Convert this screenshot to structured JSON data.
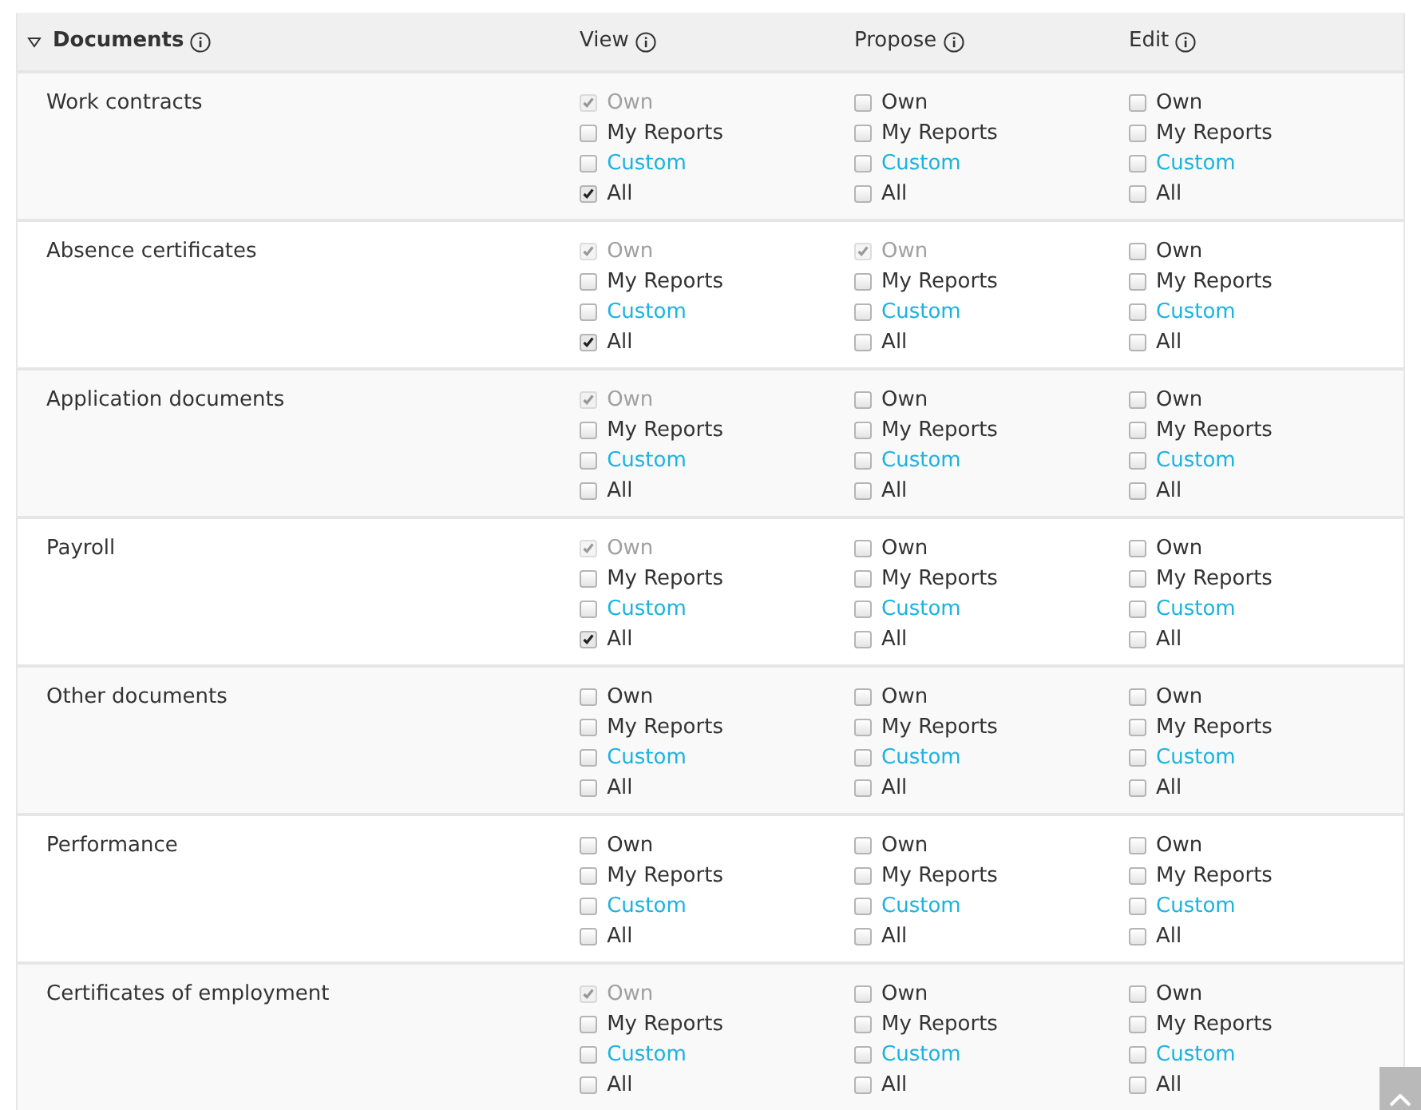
{
  "header": {
    "title": "Documents",
    "expanded": true,
    "columns": [
      "View",
      "Propose",
      "Edit"
    ]
  },
  "rows": [
    {
      "name": "Work contracts",
      "permissions": [
        [
          {
            "label": "Own",
            "kind": "plain",
            "checked": true,
            "disabled": true
          },
          {
            "label": "My Reports",
            "kind": "plain",
            "checked": false,
            "disabled": false
          },
          {
            "label": "Custom",
            "kind": "link",
            "checked": false,
            "disabled": false
          },
          {
            "label": "All",
            "kind": "plain",
            "checked": true,
            "disabled": false
          }
        ],
        [
          {
            "label": "Own",
            "kind": "plain",
            "checked": false,
            "disabled": false
          },
          {
            "label": "My Reports",
            "kind": "plain",
            "checked": false,
            "disabled": false
          },
          {
            "label": "Custom",
            "kind": "link",
            "checked": false,
            "disabled": false
          },
          {
            "label": "All",
            "kind": "plain",
            "checked": false,
            "disabled": false
          }
        ],
        [
          {
            "label": "Own",
            "kind": "plain",
            "checked": false,
            "disabled": false
          },
          {
            "label": "My Reports",
            "kind": "plain",
            "checked": false,
            "disabled": false
          },
          {
            "label": "Custom",
            "kind": "link",
            "checked": false,
            "disabled": false
          },
          {
            "label": "All",
            "kind": "plain",
            "checked": false,
            "disabled": false
          }
        ]
      ]
    },
    {
      "name": "Absence certificates",
      "permissions": [
        [
          {
            "label": "Own",
            "kind": "plain",
            "checked": true,
            "disabled": true
          },
          {
            "label": "My Reports",
            "kind": "plain",
            "checked": false,
            "disabled": false
          },
          {
            "label": "Custom",
            "kind": "link",
            "checked": false,
            "disabled": false
          },
          {
            "label": "All",
            "kind": "plain",
            "checked": true,
            "disabled": false
          }
        ],
        [
          {
            "label": "Own",
            "kind": "plain",
            "checked": true,
            "disabled": true
          },
          {
            "label": "My Reports",
            "kind": "plain",
            "checked": false,
            "disabled": false
          },
          {
            "label": "Custom",
            "kind": "link",
            "checked": false,
            "disabled": false
          },
          {
            "label": "All",
            "kind": "plain",
            "checked": false,
            "disabled": false
          }
        ],
        [
          {
            "label": "Own",
            "kind": "plain",
            "checked": false,
            "disabled": false
          },
          {
            "label": "My Reports",
            "kind": "plain",
            "checked": false,
            "disabled": false
          },
          {
            "label": "Custom",
            "kind": "link",
            "checked": false,
            "disabled": false
          },
          {
            "label": "All",
            "kind": "plain",
            "checked": false,
            "disabled": false
          }
        ]
      ]
    },
    {
      "name": "Application documents",
      "permissions": [
        [
          {
            "label": "Own",
            "kind": "plain",
            "checked": true,
            "disabled": true
          },
          {
            "label": "My Reports",
            "kind": "plain",
            "checked": false,
            "disabled": false
          },
          {
            "label": "Custom",
            "kind": "link",
            "checked": false,
            "disabled": false
          },
          {
            "label": "All",
            "kind": "plain",
            "checked": false,
            "disabled": false
          }
        ],
        [
          {
            "label": "Own",
            "kind": "plain",
            "checked": false,
            "disabled": false
          },
          {
            "label": "My Reports",
            "kind": "plain",
            "checked": false,
            "disabled": false
          },
          {
            "label": "Custom",
            "kind": "link",
            "checked": false,
            "disabled": false
          },
          {
            "label": "All",
            "kind": "plain",
            "checked": false,
            "disabled": false
          }
        ],
        [
          {
            "label": "Own",
            "kind": "plain",
            "checked": false,
            "disabled": false
          },
          {
            "label": "My Reports",
            "kind": "plain",
            "checked": false,
            "disabled": false
          },
          {
            "label": "Custom",
            "kind": "link",
            "checked": false,
            "disabled": false
          },
          {
            "label": "All",
            "kind": "plain",
            "checked": false,
            "disabled": false
          }
        ]
      ]
    },
    {
      "name": "Payroll",
      "permissions": [
        [
          {
            "label": "Own",
            "kind": "plain",
            "checked": true,
            "disabled": true
          },
          {
            "label": "My Reports",
            "kind": "plain",
            "checked": false,
            "disabled": false
          },
          {
            "label": "Custom",
            "kind": "link",
            "checked": false,
            "disabled": false
          },
          {
            "label": "All",
            "kind": "plain",
            "checked": true,
            "disabled": false
          }
        ],
        [
          {
            "label": "Own",
            "kind": "plain",
            "checked": false,
            "disabled": false
          },
          {
            "label": "My Reports",
            "kind": "plain",
            "checked": false,
            "disabled": false
          },
          {
            "label": "Custom",
            "kind": "link",
            "checked": false,
            "disabled": false
          },
          {
            "label": "All",
            "kind": "plain",
            "checked": false,
            "disabled": false
          }
        ],
        [
          {
            "label": "Own",
            "kind": "plain",
            "checked": false,
            "disabled": false
          },
          {
            "label": "My Reports",
            "kind": "plain",
            "checked": false,
            "disabled": false
          },
          {
            "label": "Custom",
            "kind": "link",
            "checked": false,
            "disabled": false
          },
          {
            "label": "All",
            "kind": "plain",
            "checked": false,
            "disabled": false
          }
        ]
      ]
    },
    {
      "name": "Other documents",
      "permissions": [
        [
          {
            "label": "Own",
            "kind": "plain",
            "checked": false,
            "disabled": false
          },
          {
            "label": "My Reports",
            "kind": "plain",
            "checked": false,
            "disabled": false
          },
          {
            "label": "Custom",
            "kind": "link",
            "checked": false,
            "disabled": false
          },
          {
            "label": "All",
            "kind": "plain",
            "checked": false,
            "disabled": false
          }
        ],
        [
          {
            "label": "Own",
            "kind": "plain",
            "checked": false,
            "disabled": false
          },
          {
            "label": "My Reports",
            "kind": "plain",
            "checked": false,
            "disabled": false
          },
          {
            "label": "Custom",
            "kind": "link",
            "checked": false,
            "disabled": false
          },
          {
            "label": "All",
            "kind": "plain",
            "checked": false,
            "disabled": false
          }
        ],
        [
          {
            "label": "Own",
            "kind": "plain",
            "checked": false,
            "disabled": false
          },
          {
            "label": "My Reports",
            "kind": "plain",
            "checked": false,
            "disabled": false
          },
          {
            "label": "Custom",
            "kind": "link",
            "checked": false,
            "disabled": false
          },
          {
            "label": "All",
            "kind": "plain",
            "checked": false,
            "disabled": false
          }
        ]
      ]
    },
    {
      "name": "Performance",
      "permissions": [
        [
          {
            "label": "Own",
            "kind": "plain",
            "checked": false,
            "disabled": false
          },
          {
            "label": "My Reports",
            "kind": "plain",
            "checked": false,
            "disabled": false
          },
          {
            "label": "Custom",
            "kind": "link",
            "checked": false,
            "disabled": false
          },
          {
            "label": "All",
            "kind": "plain",
            "checked": false,
            "disabled": false
          }
        ],
        [
          {
            "label": "Own",
            "kind": "plain",
            "checked": false,
            "disabled": false
          },
          {
            "label": "My Reports",
            "kind": "plain",
            "checked": false,
            "disabled": false
          },
          {
            "label": "Custom",
            "kind": "link",
            "checked": false,
            "disabled": false
          },
          {
            "label": "All",
            "kind": "plain",
            "checked": false,
            "disabled": false
          }
        ],
        [
          {
            "label": "Own",
            "kind": "plain",
            "checked": false,
            "disabled": false
          },
          {
            "label": "My Reports",
            "kind": "plain",
            "checked": false,
            "disabled": false
          },
          {
            "label": "Custom",
            "kind": "link",
            "checked": false,
            "disabled": false
          },
          {
            "label": "All",
            "kind": "plain",
            "checked": false,
            "disabled": false
          }
        ]
      ]
    },
    {
      "name": "Certificates of employment",
      "permissions": [
        [
          {
            "label": "Own",
            "kind": "plain",
            "checked": true,
            "disabled": true
          },
          {
            "label": "My Reports",
            "kind": "plain",
            "checked": false,
            "disabled": false
          },
          {
            "label": "Custom",
            "kind": "link",
            "checked": false,
            "disabled": false
          },
          {
            "label": "All",
            "kind": "plain",
            "checked": false,
            "disabled": false
          }
        ],
        [
          {
            "label": "Own",
            "kind": "plain",
            "checked": false,
            "disabled": false
          },
          {
            "label": "My Reports",
            "kind": "plain",
            "checked": false,
            "disabled": false
          },
          {
            "label": "Custom",
            "kind": "link",
            "checked": false,
            "disabled": false
          },
          {
            "label": "All",
            "kind": "plain",
            "checked": false,
            "disabled": false
          }
        ],
        [
          {
            "label": "Own",
            "kind": "plain",
            "checked": false,
            "disabled": false
          },
          {
            "label": "My Reports",
            "kind": "plain",
            "checked": false,
            "disabled": false
          },
          {
            "label": "Custom",
            "kind": "link",
            "checked": false,
            "disabled": false
          },
          {
            "label": "All",
            "kind": "plain",
            "checked": false,
            "disabled": false
          }
        ]
      ]
    }
  ]
}
